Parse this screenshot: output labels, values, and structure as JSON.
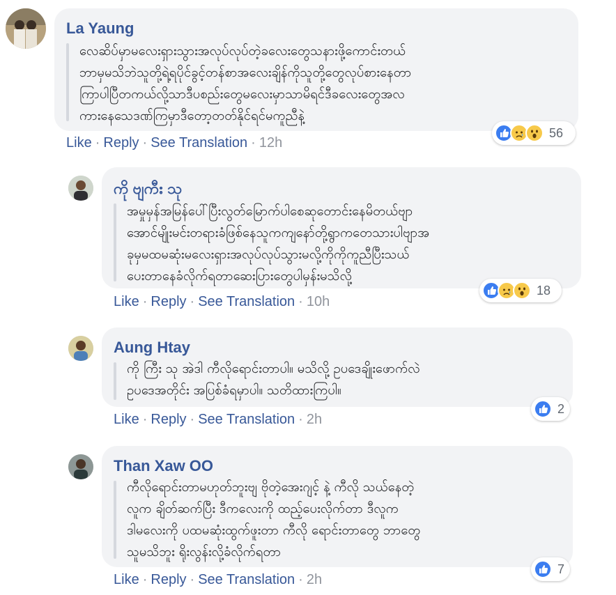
{
  "comments": [
    {
      "author": "La Yaung",
      "lines": [
        "လေဆိပ်မှာမလေးရှားသွားအလုပ်လုပ်တဲ့ခလေးတွေသနားဖို့ကောင်းတယ်",
        "ဘာမှမသိဘဲသူတို့ရဲ့ရပိုင်ခွင့်တန်စာအလေးချိန်ကိုသူတို့တွေလုပ်စားနေတာ",
        "ကြာပါပြီတကယ်လို့သာဒီပစည်းတွေမလေးမှာသာမိရင်ဒီခလေးတွေအလ",
        "ကားနေသေဒဏ်ကြမှာဒီတော့တတ်နိုင်ရင်မကူညီနဲ့"
      ],
      "actions": {
        "like": "Like",
        "reply": "Reply",
        "translate": "See Translation",
        "time": "12h"
      },
      "reaction_count": "56",
      "reaction_icons": [
        "like-icon",
        "sad-icon",
        "wow-icon"
      ]
    },
    {
      "author": "ကို ဗျကီး သု",
      "lines": [
        "အမှုမှန်အမြန်ပေါ်ပြီးလွတ်မြောက်ပါစေဆုတောင်းနေမိတယ်ဗျာ",
        "အောင်မျိုးမင်းတရားခံဖြစ်နေသူကကျနော်တို့ရွာကတေသားပါဗျာအ",
        "ခုမှမထမဆုံးမလေးရှားအလုပ်လုပ်သွားမလို့ကိုကိုကူညီပြီးသယ်",
        "ပေးတာနေခံလိုက်ရတာဆေးပြားတွေပါမှန်းမသိလို့"
      ],
      "actions": {
        "like": "Like",
        "reply": "Reply",
        "translate": "See Translation",
        "time": "10h"
      },
      "reaction_count": "18",
      "reaction_icons": [
        "like-icon",
        "sad-icon",
        "wow-icon"
      ]
    },
    {
      "author": "Aung Htay",
      "lines": [
        "ကို ကြီး သု အဲဒါ ကီလိုရောင်းတာပါ။ မသိလို့ ဥပဒေချိုးဖောက်လဲ",
        "ဥပဒေအတိုင်း အပြစ်ခံရမှာပါ။ သတိထားကြပါ။"
      ],
      "actions": {
        "like": "Like",
        "reply": "Reply",
        "translate": "See Translation",
        "time": "2h"
      },
      "reaction_count": "2",
      "reaction_icons": [
        "like-icon"
      ]
    },
    {
      "author": "Than Xaw OO",
      "lines": [
        "ကီလိုရောင်းတာမဟုတ်ဘူးဗျ ဗိုတဲ့အေးဂျင့် နဲ့ ကီလို သယ်နေတဲ့",
        "လူက ချိတ်ဆက်ပြီး ဒီကလေးကို ထည့်ပေးလိုက်တာ ဒီလူက",
        "ဒါမလေးကို ပထမဆုံးထွက်ဖူးတာ ကီလို ရောင်းတာတွေ ဘာတွေ",
        "သူမသိဘူး ရိုးလွန်းလို့ခံလိုက်ရတာ"
      ],
      "actions": {
        "like": "Like",
        "reply": "Reply",
        "translate": "See Translation",
        "time": "2h"
      },
      "reaction_count": "7",
      "reaction_icons": [
        "like-icon"
      ]
    }
  ]
}
